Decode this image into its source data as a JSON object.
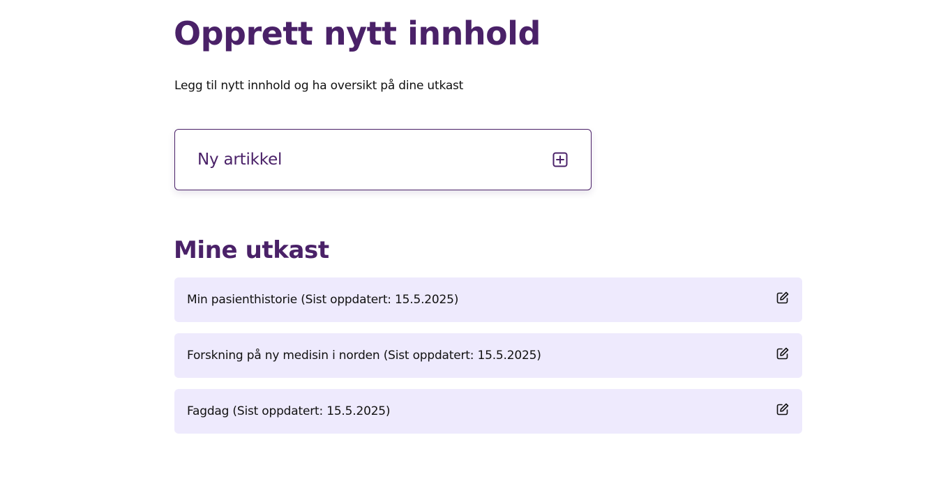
{
  "header": {
    "title": "Opprett nytt innhold",
    "intro": "Legg til nytt innhold og ha oversikt på dine utkast"
  },
  "new_article": {
    "label": "Ny artikkel",
    "icon": "plus-square-icon"
  },
  "drafts": {
    "title": "Mine utkast",
    "items": [
      {
        "text": "Min pasienthistorie (Sist oppdatert: 15.5.2025)",
        "icon": "edit-icon"
      },
      {
        "text": "Forskning på ny medisin i norden (Sist oppdatert: 15.5.2025)",
        "icon": "edit-icon"
      },
      {
        "text": "Fagdag (Sist oppdatert: 15.5.2025)",
        "icon": "edit-icon"
      }
    ]
  },
  "colors": {
    "accent": "#4a2168",
    "draft_background": "#eeeafd",
    "text": "#111111",
    "background": "#ffffff"
  }
}
